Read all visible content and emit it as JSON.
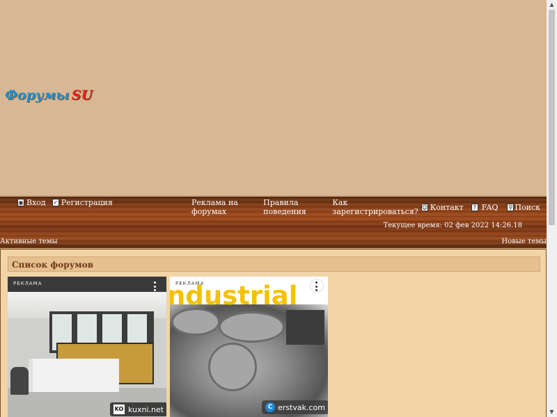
{
  "logo": {
    "part1": "Форумы",
    "part2": "SU"
  },
  "nav_left": [
    {
      "label": "Вход",
      "icon": "login-icon"
    },
    {
      "label": "Регистрация",
      "icon": "register-icon"
    }
  ],
  "nav_right": {
    "ads": "Реклама на форумах",
    "rules": "Правила поведения",
    "howto": "Как зарегистрироваться?",
    "contact": "Контакт",
    "faq": "FAQ",
    "search": "Поиск"
  },
  "current_time": "Текущее время: 02 фев 2022 14:26.18",
  "links": {
    "active": "Активные темы",
    "new": "Новые темы"
  },
  "forum_list_title": "Список форумов",
  "ads": [
    {
      "label": "РЕКЛАМА",
      "site": "kuxni.net",
      "logo": "KO"
    },
    {
      "label": "РЕКЛАМА",
      "headline": "ndustrial",
      "site": "erstvak.com",
      "logo": "C"
    }
  ]
}
